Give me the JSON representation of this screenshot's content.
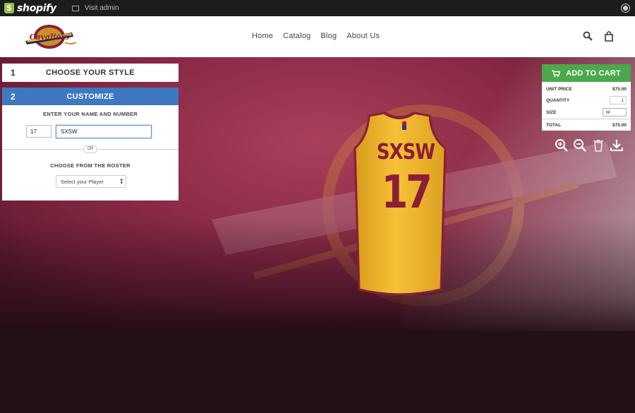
{
  "admin_bar": {
    "brand": "shopify",
    "visit_label": "Visit admin"
  },
  "header": {
    "nav": [
      "Home",
      "Catalog",
      "Blog",
      "About Us"
    ],
    "logo_icon": "cavaliers-logo"
  },
  "customizer": {
    "step1": {
      "number": "1",
      "title": "CHOOSE YOUR STYLE"
    },
    "step2": {
      "number": "2",
      "title": "CUSTOMIZE",
      "name_number_label": "ENTER YOUR NAME AND NUMBER",
      "number_value": "17",
      "name_value": "SXSW",
      "or_label": "OR",
      "roster_label": "CHOOSE FROM THE ROSTER",
      "roster_select": "Select your Player"
    }
  },
  "cart": {
    "button_label": "ADD TO CART",
    "unit_price_label": "UNIT PRICE",
    "unit_price": "$75.00",
    "quantity_label": "QUANTITY",
    "quantity": "1",
    "size_label": "SIZE",
    "size": "M",
    "total_label": "TOTAL",
    "total": "$75.00"
  },
  "jersey": {
    "name": "SXSW",
    "number": "17"
  },
  "colors": {
    "accent_blue": "#3e78c0",
    "cart_green": "#4ca84a",
    "wine": "#8d2c47",
    "gold": "#f2b630"
  }
}
